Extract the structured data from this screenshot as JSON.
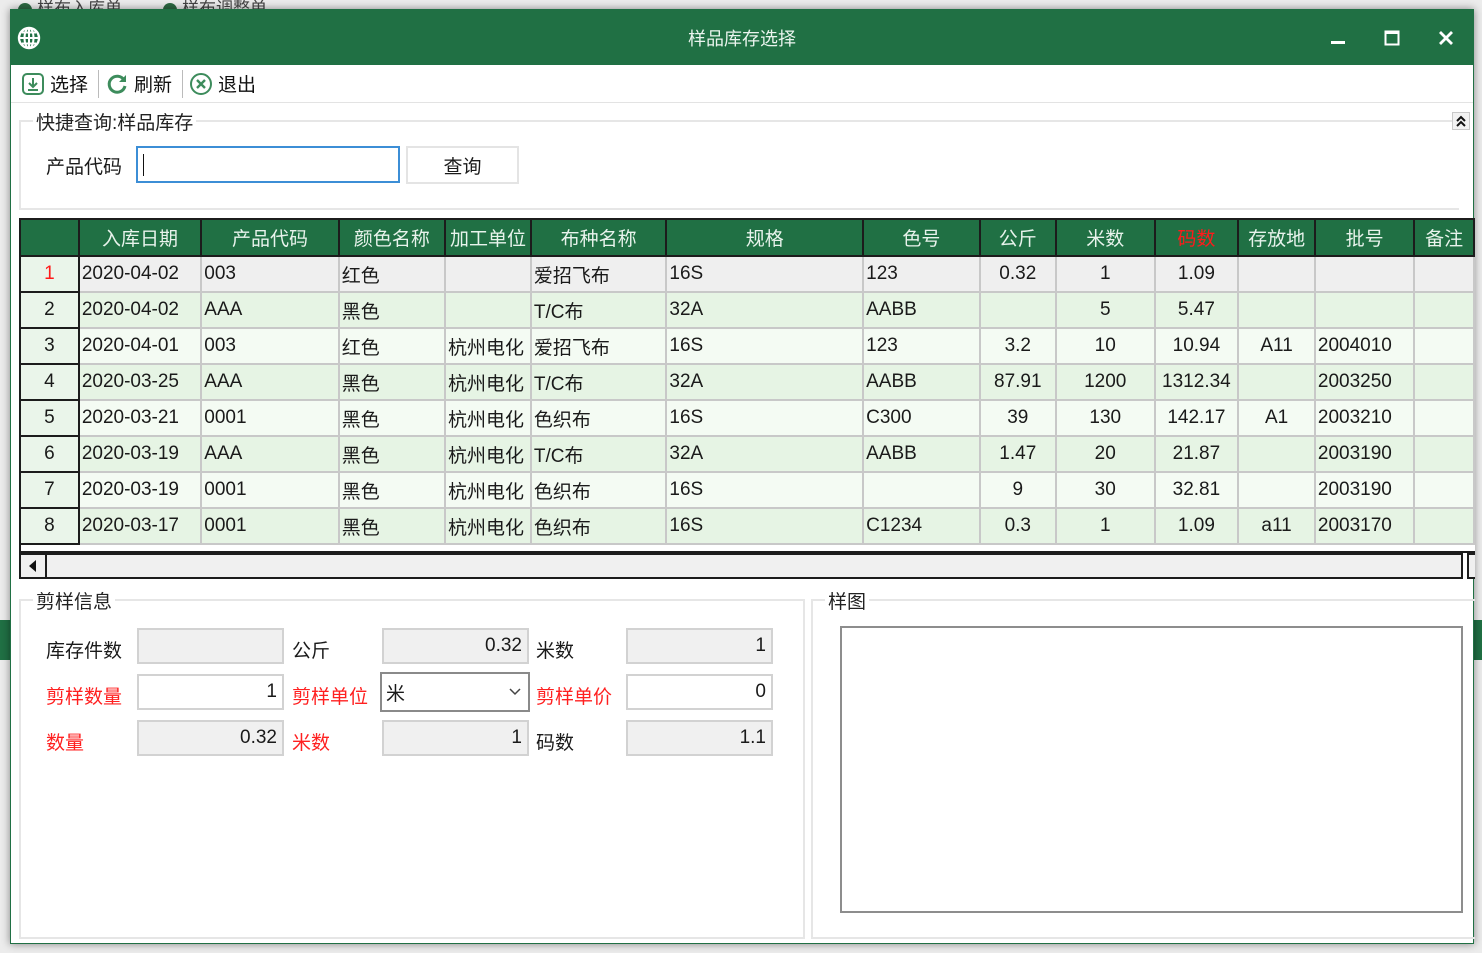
{
  "background_window": {
    "tabs": [
      "样布入库单",
      "样布调整单"
    ]
  },
  "dialog": {
    "title": "样品库存选择",
    "icon": "globe-icon",
    "window_controls": [
      "minimize",
      "maximize",
      "close"
    ]
  },
  "toolbar": {
    "items": [
      {
        "label": "选择",
        "icon": "download-icon"
      },
      {
        "label": "刷新",
        "icon": "refresh-icon"
      },
      {
        "label": "退出",
        "icon": "close-circle-icon"
      }
    ]
  },
  "quick_query": {
    "legend": "快捷查询:样品库存",
    "product_code_label": "产品代码",
    "product_code_value": "",
    "query_button": "查询"
  },
  "grid": {
    "columns": [
      "",
      "入库日期",
      "产品代码",
      "颜色名称",
      "加工单位",
      "布种名称",
      "规格",
      "色号",
      "公斤",
      "米数",
      "码数",
      "存放地",
      "批号",
      "备注"
    ],
    "highlight_column": "码数",
    "selected_row": 1,
    "rows": [
      {
        "no": "1",
        "date": "2020-04-02",
        "code": "003",
        "color": "红色",
        "processor": "",
        "fabric": "爱招飞布",
        "spec": "16S",
        "color_no": "123",
        "kg": "0.32",
        "meters": "1",
        "yards": "1.09",
        "location": "",
        "batch": "",
        "remark": ""
      },
      {
        "no": "2",
        "date": "2020-04-02",
        "code": "AAA",
        "color": "黑色",
        "processor": "",
        "fabric": "T/C布",
        "spec": "32A",
        "color_no": "AABB",
        "kg": "",
        "meters": "5",
        "yards": "5.47",
        "location": "",
        "batch": "",
        "remark": ""
      },
      {
        "no": "3",
        "date": "2020-04-01",
        "code": "003",
        "color": "红色",
        "processor": "杭州电化",
        "fabric": "爱招飞布",
        "spec": "16S",
        "color_no": "123",
        "kg": "3.2",
        "meters": "10",
        "yards": "10.94",
        "location": "A11",
        "batch": "2004010",
        "remark": ""
      },
      {
        "no": "4",
        "date": "2020-03-25",
        "code": "AAA",
        "color": "黑色",
        "processor": "杭州电化",
        "fabric": "T/C布",
        "spec": "32A",
        "color_no": "AABB",
        "kg": "87.91",
        "meters": "1200",
        "yards": "1312.34",
        "location": "",
        "batch": "2003250",
        "remark": ""
      },
      {
        "no": "5",
        "date": "2020-03-21",
        "code": "0001",
        "color": "黑色",
        "processor": "杭州电化",
        "fabric": "色织布",
        "spec": "16S",
        "color_no": "C300",
        "kg": "39",
        "meters": "130",
        "yards": "142.17",
        "location": "A1",
        "batch": "2003210",
        "remark": ""
      },
      {
        "no": "6",
        "date": "2020-03-19",
        "code": "AAA",
        "color": "黑色",
        "processor": "杭州电化",
        "fabric": "T/C布",
        "spec": "32A",
        "color_no": "AABB",
        "kg": "1.47",
        "meters": "20",
        "yards": "21.87",
        "location": "",
        "batch": "2003190",
        "remark": ""
      },
      {
        "no": "7",
        "date": "2020-03-19",
        "code": "0001",
        "color": "黑色",
        "processor": "杭州电化",
        "fabric": "色织布",
        "spec": "16S",
        "color_no": "",
        "kg": "9",
        "meters": "30",
        "yards": "32.81",
        "location": "",
        "batch": "2003190",
        "remark": ""
      },
      {
        "no": "8",
        "date": "2020-03-17",
        "code": "0001",
        "color": "黑色",
        "processor": "杭州电化",
        "fabric": "色织布",
        "spec": "16S",
        "color_no": "C1234",
        "kg": "0.3",
        "meters": "1",
        "yards": "1.09",
        "location": "a11",
        "batch": "2003170",
        "remark": ""
      }
    ]
  },
  "cut_info": {
    "legend": "剪样信息",
    "stock_pieces_label": "库存件数",
    "stock_pieces_value": "",
    "kg_label": "公斤",
    "kg_value": "0.32",
    "meters_label": "米数",
    "meters_value": "1",
    "cut_qty_label": "剪样数量",
    "cut_qty_value": "1",
    "cut_unit_label": "剪样单位",
    "cut_unit_value": "米",
    "cut_price_label": "剪样单价",
    "cut_price_value": "0",
    "qty_label": "数量",
    "qty_value": "0.32",
    "meters2_label": "米数",
    "meters2_value": "1",
    "yards_label": "码数",
    "yards_value": "1.1"
  },
  "sample_image": {
    "legend": "样图"
  },
  "colors": {
    "brand_green": "#207044",
    "required_label_red": "#ff2020",
    "focus_blue": "#3c8ed6"
  }
}
